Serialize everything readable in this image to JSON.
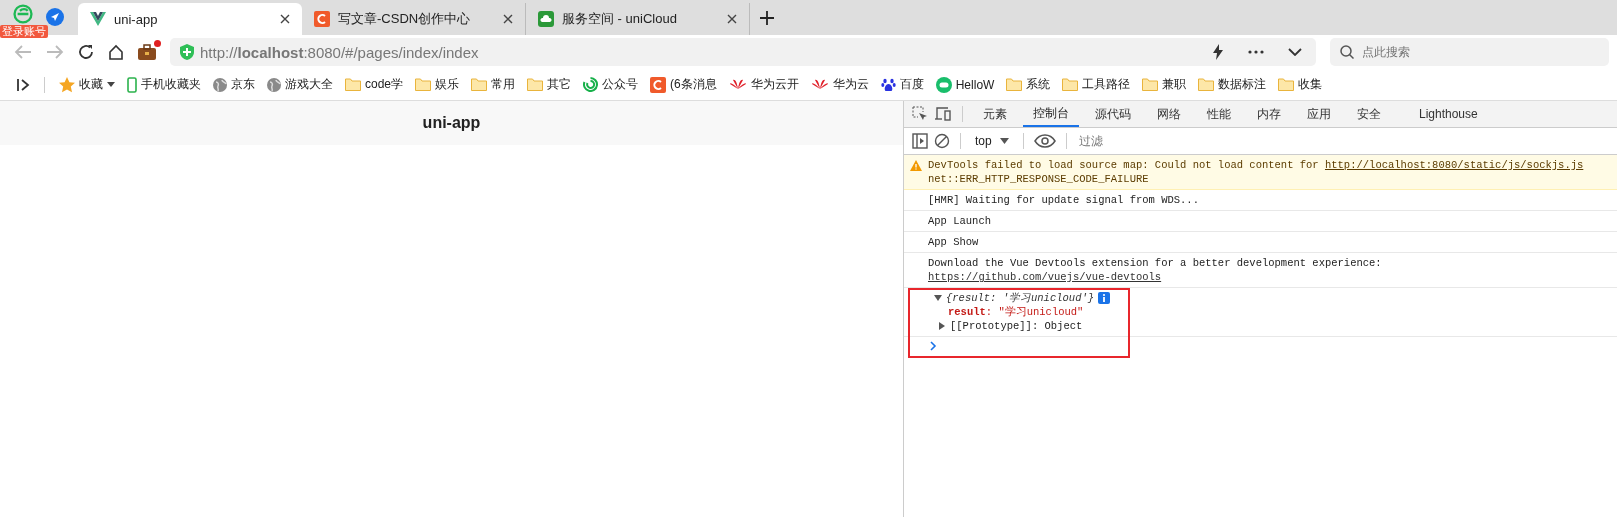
{
  "browser": {
    "logo_badge": "登录账号",
    "tabs": [
      {
        "title": "uni-app",
        "kind": "vue",
        "selected": true
      },
      {
        "title": "写文章-CSDN创作中心",
        "kind": "csdn",
        "selected": false
      },
      {
        "title": "服务空间 - uniCloud",
        "kind": "unicloud",
        "selected": false
      }
    ],
    "address_bar": {
      "url": "http://**localhost**:8080/#/pages/index/index",
      "notification": true,
      "search_placeholder": "点此搜索"
    },
    "bookmarks": [
      {
        "label": "收藏",
        "kind": "star",
        "dropdown": true
      },
      {
        "label": "手机收藏夹",
        "kind": "phone",
        "dropdown": false
      },
      {
        "label": "京东",
        "kind": "globe",
        "dropdown": false
      },
      {
        "label": "游戏大全",
        "kind": "globe",
        "dropdown": false
      },
      {
        "label": "code学",
        "kind": "folder",
        "dropdown": false
      },
      {
        "label": "娱乐",
        "kind": "folder",
        "dropdown": false
      },
      {
        "label": "常用",
        "kind": "folder",
        "dropdown": false
      },
      {
        "label": "其它",
        "kind": "folder",
        "dropdown": false
      },
      {
        "label": "公众号",
        "kind": "swirl",
        "dropdown": false
      },
      {
        "label": "(6条消息",
        "kind": "csdn",
        "dropdown": false
      },
      {
        "label": "华为云开",
        "kind": "flower",
        "dropdown": false
      },
      {
        "label": "华为云",
        "kind": "flower",
        "dropdown": false
      },
      {
        "label": "百度",
        "kind": "paw",
        "dropdown": false
      },
      {
        "label": "HelloW",
        "kind": "chat",
        "dropdown": false
      },
      {
        "label": "系统",
        "kind": "folder",
        "dropdown": false
      },
      {
        "label": "工具路径",
        "kind": "folder",
        "dropdown": false
      },
      {
        "label": "兼职",
        "kind": "folder",
        "dropdown": false
      },
      {
        "label": "数据标注",
        "kind": "folder",
        "dropdown": false
      },
      {
        "label": "收集",
        "kind": "folder",
        "dropdown": false
      }
    ]
  },
  "page": {
    "title": "uni-app"
  },
  "devtools": {
    "tabs": [
      {
        "label": "元素",
        "selected": false
      },
      {
        "label": "控制台",
        "selected": true
      },
      {
        "label": "源代码",
        "selected": false
      },
      {
        "label": "网络",
        "selected": false
      },
      {
        "label": "性能",
        "selected": false
      },
      {
        "label": "内存",
        "selected": false
      },
      {
        "label": "应用",
        "selected": false
      },
      {
        "label": "安全",
        "selected": false
      },
      {
        "label": "Lighthouse",
        "selected": false
      }
    ],
    "console_toolbar": {
      "context": "top",
      "filter_placeholder": "过滤"
    },
    "messages": [
      {
        "kind": "warning",
        "text": "DevTools failed to load source map: Could not load content for ",
        "link": "http://localhost:8080/static/js/sockjs.js",
        "detail": "net::ERR_HTTP_RESPONSE_CODE_FAILURE"
      },
      {
        "kind": "log",
        "text": "[HMR] Waiting for update signal from WDS..."
      },
      {
        "kind": "log",
        "text": "App Launch"
      },
      {
        "kind": "log",
        "text": "App Show"
      },
      {
        "kind": "log",
        "text": "Download the Vue Devtools extension for a better development experience:",
        "link": "https://github.com/vuejs/vue-devtools"
      },
      {
        "kind": "object",
        "expanded": true,
        "highlighted": true,
        "summary": "{result: *'学习unicloud'*}",
        "properties": [
          {
            "text": "**result**: \"学习unicloud\""
          }
        ],
        "prototype": {
          "text": "[[Prototype]]: Object",
          "expanded": false
        }
      }
    ]
  }
}
